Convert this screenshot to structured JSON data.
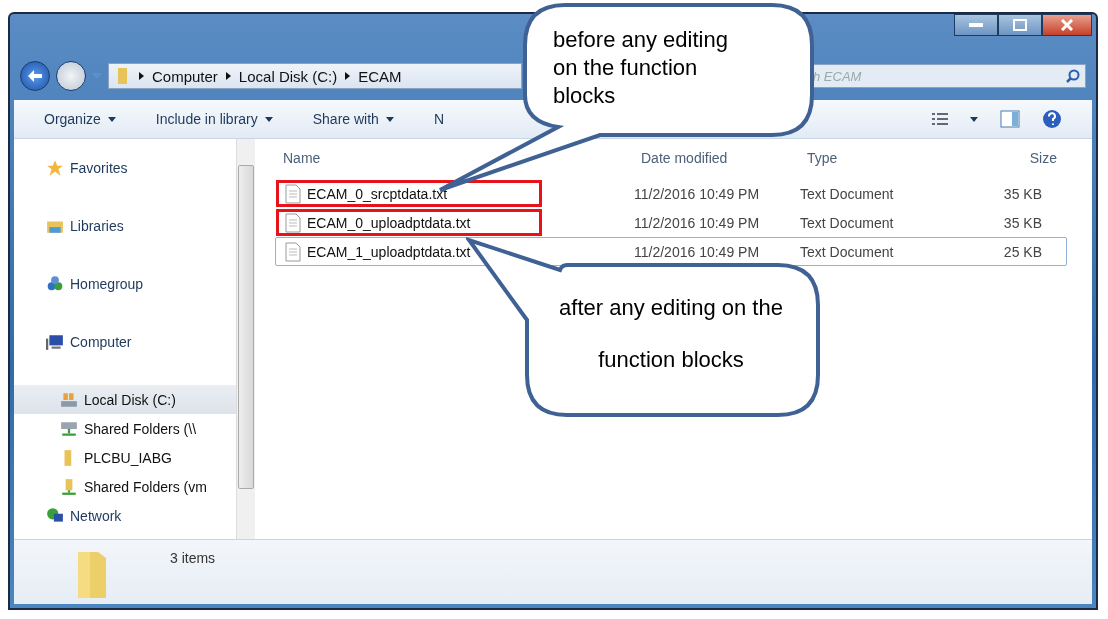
{
  "address": {
    "crumbs": [
      "Computer",
      "Local Disk (C:)",
      "ECAM"
    ]
  },
  "search": {
    "placeholder": "h ECAM"
  },
  "toolbar": {
    "items": [
      {
        "label": "Organize",
        "dropdown": true
      },
      {
        "label": "Include in library",
        "dropdown": true
      },
      {
        "label": "Share with",
        "dropdown": true
      },
      {
        "label": "N",
        "dropdown": false
      }
    ]
  },
  "sidebar": {
    "items": [
      {
        "label": "Favorites",
        "kind": "star",
        "selected": false
      },
      {
        "label": "Libraries",
        "kind": "library",
        "selected": false
      },
      {
        "label": "Homegroup",
        "kind": "homegroup",
        "selected": false
      },
      {
        "label": "Computer",
        "kind": "computer",
        "selected": false,
        "children": [
          {
            "label": "Local Disk (C:)",
            "kind": "drive",
            "selected": true
          },
          {
            "label": "Shared Folders (\\\\",
            "kind": "netdrive",
            "selected": false
          },
          {
            "label": "PLCBU_IABG",
            "kind": "folder",
            "selected": false
          },
          {
            "label": "Shared Folders (vm",
            "kind": "share",
            "selected": false
          }
        ]
      },
      {
        "label": "Network",
        "kind": "network",
        "selected": false
      }
    ]
  },
  "table": {
    "columns": [
      "Name",
      "Date modified",
      "Type",
      "Size"
    ],
    "rows": [
      {
        "name": "ECAM_0_srcptdata.txt",
        "modified": "11/2/2016 10:49 PM",
        "type": "Text Document",
        "size": "35 KB",
        "highlighted": true,
        "focused": false
      },
      {
        "name": "ECAM_0_uploadptdata.txt",
        "modified": "11/2/2016 10:49 PM",
        "type": "Text Document",
        "size": "35 KB",
        "highlighted": true,
        "focused": false
      },
      {
        "name": "ECAM_1_uploadptdata.txt",
        "modified": "11/2/2016 10:49 PM",
        "type": "Text Document",
        "size": "25 KB",
        "highlighted": false,
        "focused": true
      }
    ]
  },
  "status_bar": {
    "text": "3 items"
  },
  "callouts": [
    {
      "kind": "top",
      "text": "before any editing on the function blocks"
    },
    {
      "kind": "bottom",
      "text": "after any editing on the function blocks"
    }
  ]
}
